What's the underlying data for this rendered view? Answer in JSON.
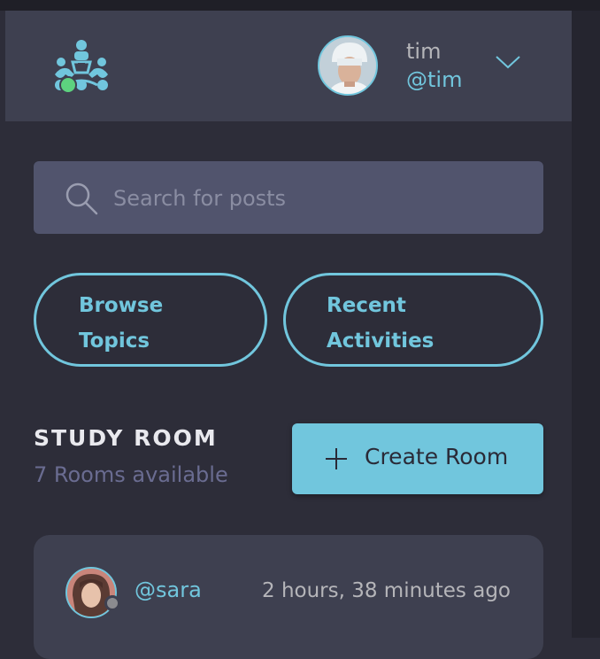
{
  "header": {
    "logo_icon": "study-group-icon",
    "user": {
      "name": "tim",
      "handle": "@tim",
      "status": "online",
      "status_color": "#5dd27f"
    },
    "menu_icon": "chevron-down-icon"
  },
  "search": {
    "placeholder": "Search for posts",
    "value": "",
    "icon": "search-icon"
  },
  "filters": {
    "browse_line1": "Browse",
    "browse_line2": "Topics",
    "recent_line1": "Recent",
    "recent_line2": "Activities"
  },
  "study_room": {
    "title": "STUDY ROOM",
    "count_text": "7 Rooms available",
    "create_label": "Create Room",
    "create_icon": "plus-icon"
  },
  "rooms": [
    {
      "host_handle": "@sara",
      "time_ago": "2 hours, 38 minutes ago",
      "host_status": "offline"
    }
  ],
  "colors": {
    "accent": "#71c6dd",
    "background": "#2d2d39",
    "panel": "#3e4050",
    "muted_accent": "#6a6c91"
  }
}
